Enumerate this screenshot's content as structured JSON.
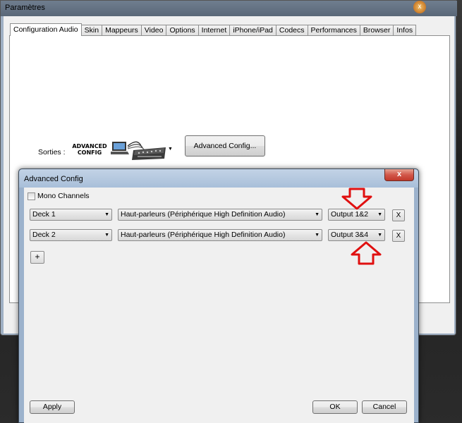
{
  "main_window": {
    "title": "Paramètres",
    "close_label": "x",
    "tabs": [
      {
        "label": "Configuration Audio",
        "active": true
      },
      {
        "label": "Skin"
      },
      {
        "label": "Mappeurs"
      },
      {
        "label": "Video"
      },
      {
        "label": "Options"
      },
      {
        "label": "Internet"
      },
      {
        "label": "iPhone/iPad"
      },
      {
        "label": "Codecs"
      },
      {
        "label": "Performances"
      },
      {
        "label": "Browser"
      },
      {
        "label": "Infos"
      }
    ],
    "sorties_label": "Sorties :",
    "output_select": {
      "logo_text": "ADVANCED CONFIG",
      "icon": "laptop-mixer-icon"
    },
    "advanced_config_button": "Advanced Config..."
  },
  "dialog": {
    "title": "Advanced Config",
    "close_label": "x",
    "mono_channels_label": "Mono Channels",
    "mono_channels_checked": false,
    "rows": [
      {
        "deck": "Deck 1",
        "device": "Haut-parleurs (Périphérique High Definition Audio)",
        "output": "Output 1&2",
        "remove_label": "X"
      },
      {
        "deck": "Deck 2",
        "device": "Haut-parleurs (Périphérique High Definition Audio)",
        "output": "Output 3&4",
        "remove_label": "X"
      }
    ],
    "add_label": "+",
    "apply_label": "Apply",
    "ok_label": "OK",
    "cancel_label": "Cancel"
  },
  "colors": {
    "annotation_arrow": "#e01010",
    "dialog_close": "#c1382a"
  }
}
